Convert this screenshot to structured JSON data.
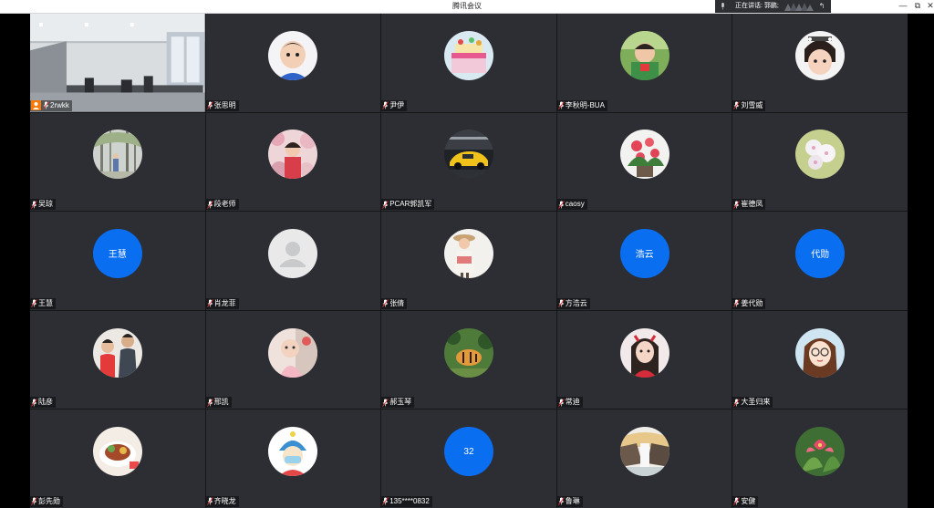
{
  "window": {
    "title": "腾讯会议",
    "speaking_label": "正在讲话: 郭鹏;",
    "minimize_icon": "—",
    "maximize_icon": "⧉",
    "close_icon": "✕",
    "back_icon": "↰"
  },
  "colors": {
    "tile_bg": "#2c2e33",
    "grid_gap": "#151618",
    "letter_avatar_bg": "#0a6ef0",
    "host_badge": "#f57a0a"
  },
  "participants": [
    {
      "name": "2rwkk",
      "avatar": "video-feed",
      "host": true
    },
    {
      "name": "张思明",
      "avatar": "baby-photo"
    },
    {
      "name": "尹伊",
      "avatar": "cake-photo"
    },
    {
      "name": "李秋明-BUA",
      "avatar": "child-photo"
    },
    {
      "name": "刘雪威",
      "avatar": "girl-photo"
    },
    {
      "name": "吴琼",
      "avatar": "trees-photo"
    },
    {
      "name": "段老师",
      "avatar": "flowers-photo"
    },
    {
      "name": "PCAR郭凯军",
      "avatar": "car-photo"
    },
    {
      "name": "caosy",
      "avatar": "plant-photo"
    },
    {
      "name": "崔德凤",
      "avatar": "blossom-photo"
    },
    {
      "name": "王慧",
      "avatar": "letter",
      "avatar_text": "王慧"
    },
    {
      "name": "肖龙菲",
      "avatar": "default-user"
    },
    {
      "name": "张倩",
      "avatar": "woman-photo"
    },
    {
      "name": "方浩云",
      "avatar": "letter",
      "avatar_text": "浩云"
    },
    {
      "name": "姜代勋",
      "avatar": "letter",
      "avatar_text": "代勋"
    },
    {
      "name": "陆彦",
      "avatar": "kids-photo"
    },
    {
      "name": "邢凯",
      "avatar": "baby-pink-photo"
    },
    {
      "name": "郝玉琴",
      "avatar": "tiger-photo"
    },
    {
      "name": "常迪",
      "avatar": "woman-portrait"
    },
    {
      "name": "大圣归来",
      "avatar": "cartoon-girl"
    },
    {
      "name": "彭先勋",
      "avatar": "food-photo"
    },
    {
      "name": "齐晓龙",
      "avatar": "cartoon-mask"
    },
    {
      "name": "135****0832",
      "avatar": "letter",
      "avatar_text": "32"
    },
    {
      "name": "鲁琳",
      "avatar": "waterfall-photo"
    },
    {
      "name": "安健",
      "avatar": "flower-red-photo"
    }
  ]
}
